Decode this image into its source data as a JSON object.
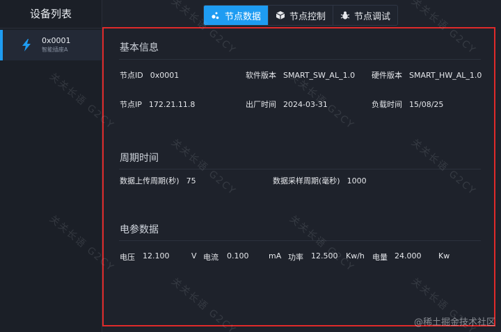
{
  "sidebar": {
    "title": "设备列表",
    "devices": [
      {
        "id": "0x0001",
        "type": "智能插座A"
      }
    ]
  },
  "tabs": [
    {
      "label": "节点数据",
      "icon": "data-dots-icon",
      "active": true
    },
    {
      "label": "节点控制",
      "icon": "cube-icon",
      "active": false
    },
    {
      "label": "节点调试",
      "icon": "bug-icon",
      "active": false
    }
  ],
  "basic_info": {
    "title": "基本信息",
    "node_id_label": "节点ID",
    "node_id_value": "0x0001",
    "sw_label": "软件版本",
    "sw_value": "SMART_SW_AL_1.0",
    "hw_label": "硬件版本",
    "hw_value": "SMART_HW_AL_1.0",
    "ip_label": "节点IP",
    "ip_value": "172.21.11.8",
    "mfg_label": "出厂时间",
    "mfg_value": "2024-03-31",
    "load_label": "负载时间",
    "load_value": "15/08/25"
  },
  "period": {
    "title": "周期时间",
    "upload_label": "数据上传周期(秒)",
    "upload_value": "75",
    "sample_label": "数据采样周期(毫秒)",
    "sample_value": "1000"
  },
  "electric": {
    "title": "电参数据",
    "voltage_label": "电压",
    "voltage_value": "12.100",
    "voltage_unit": "V",
    "current_label": "电流",
    "current_value": "0.100",
    "current_unit": "mA",
    "power_label": "功率",
    "power_value": "12.500",
    "power_unit": "Kw/h",
    "energy_label": "电量",
    "energy_value": "24.000",
    "energy_unit": "Kw"
  },
  "watermark": {
    "text": "关关长语  G2CY",
    "credit": "@稀土掘金技术社区"
  },
  "colors": {
    "accent": "#1e9cf2",
    "highlight_border": "#e02a2a",
    "background": "#1e222b"
  }
}
